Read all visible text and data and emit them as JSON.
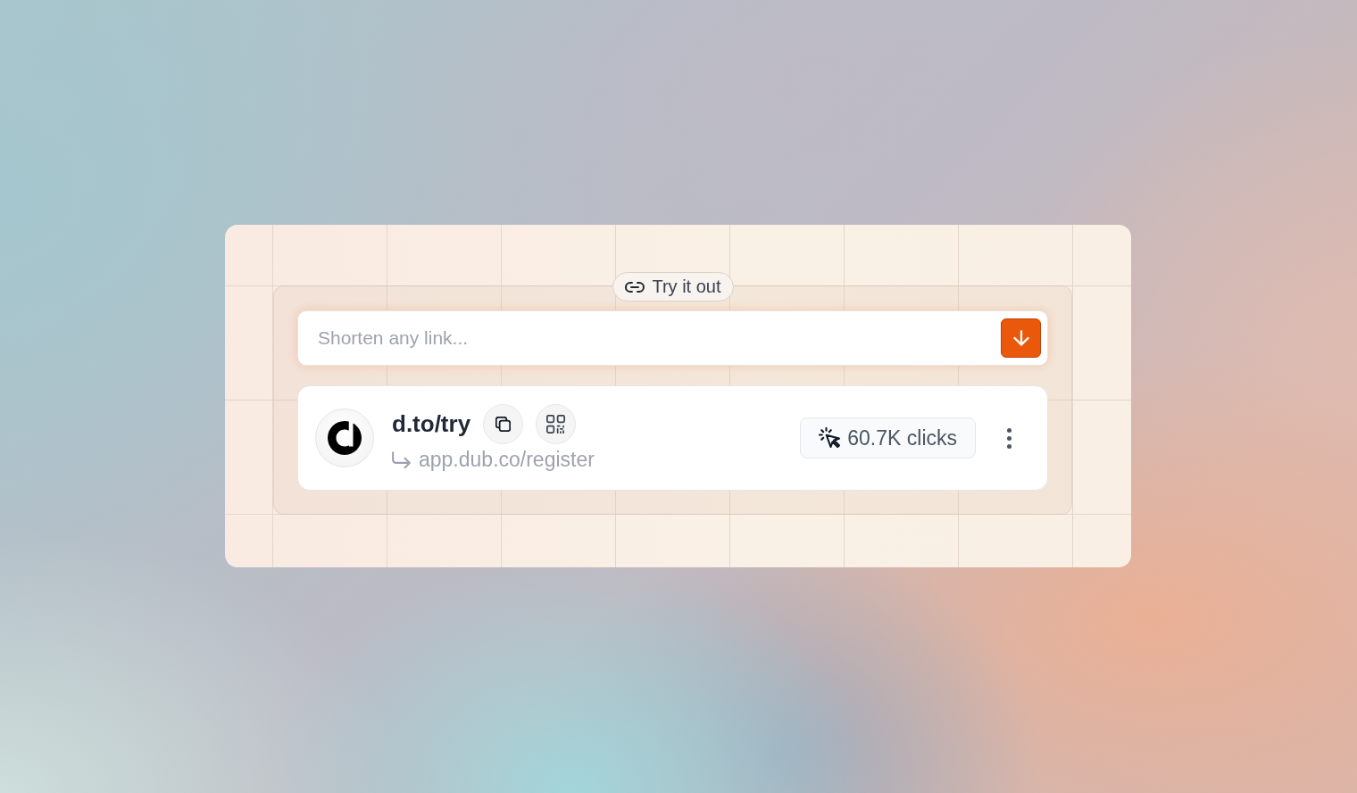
{
  "badge": {
    "label": "Try it out"
  },
  "shortener": {
    "placeholder": "Shorten any link..."
  },
  "link": {
    "short_url": "d.to/try",
    "destination": "app.dub.co/register",
    "clicks": "60.7K clicks"
  }
}
